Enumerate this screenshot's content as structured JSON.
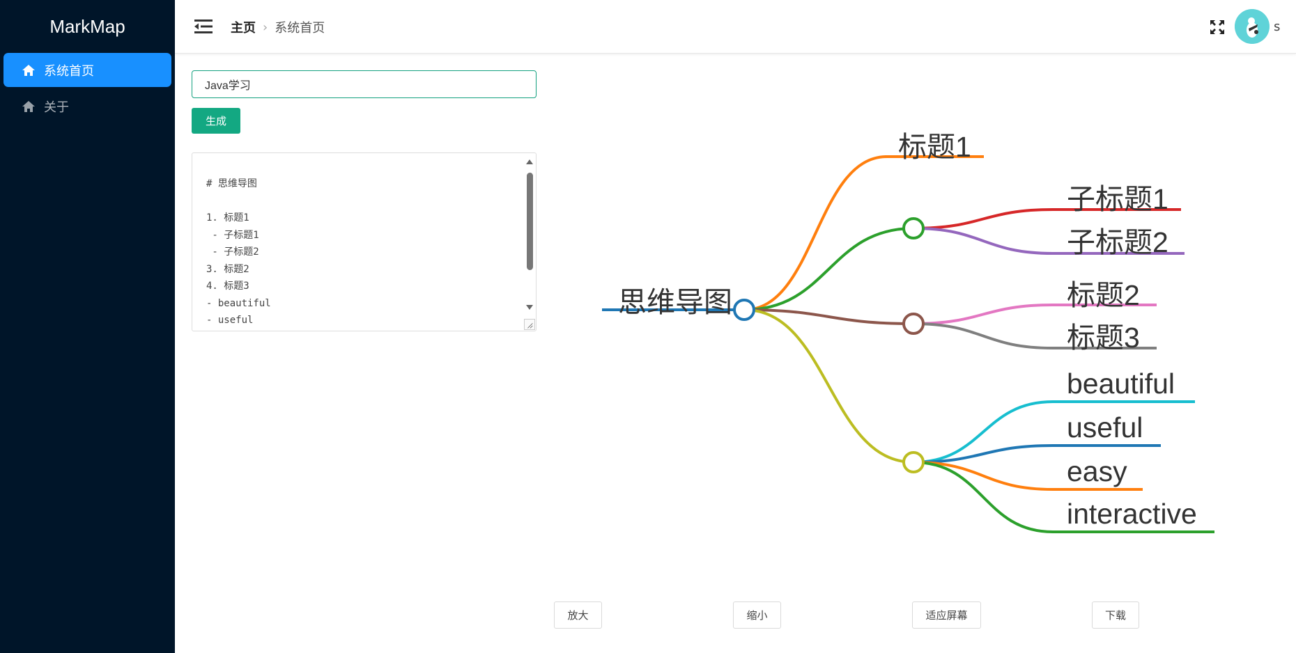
{
  "app": {
    "title": "MarkMap"
  },
  "sidebar": {
    "items": [
      {
        "label": "系统首页",
        "icon": "home-icon",
        "active": true
      },
      {
        "label": "关于",
        "icon": "home-icon",
        "active": false
      }
    ]
  },
  "header": {
    "breadcrumb": {
      "home": "主页",
      "current": "系统首页"
    },
    "username": "s"
  },
  "editor": {
    "title_value": "Java学习",
    "generate_label": "生成",
    "markdown": "# 思维导图\n\n1. 标题1\n - 子标题1\n - 子标题2\n3. 标题2\n4. 标题3\n- beautiful\n- useful"
  },
  "mindmap": {
    "root": "思维导图",
    "nodes": {
      "t1": "标题1",
      "sub1": "子标题1",
      "sub2": "子标题2",
      "t2": "标题2",
      "t3": "标题3",
      "beautiful": "beautiful",
      "useful": "useful",
      "easy": "easy",
      "interactive": "interactive"
    },
    "colors": {
      "root": "#1f77b4",
      "t1": "#ff7f0e",
      "group_a": "#2ca02c",
      "sub1": "#d62728",
      "sub2": "#9467bd",
      "group_b": "#8c564b",
      "t2": "#e377c2",
      "t3": "#7f7f7f",
      "group_c": "#bcbd22",
      "beautiful": "#17becf",
      "useful": "#1f77b4",
      "easy": "#ff7f0e",
      "interactive": "#2ca02c"
    }
  },
  "controls": {
    "zoom_in": "放大",
    "zoom_out": "缩小",
    "fit": "适应屏幕",
    "download": "下载"
  }
}
